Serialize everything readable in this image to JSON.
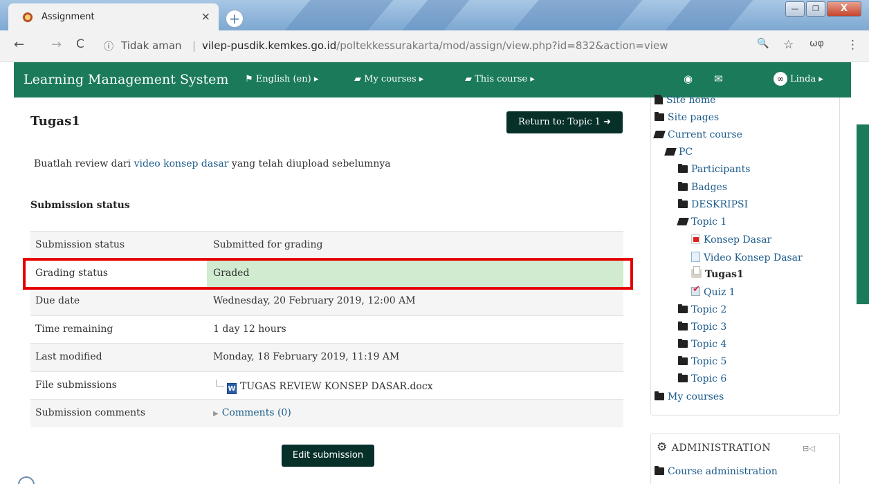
{
  "browser": {
    "tab_title": "Assignment",
    "tab_close": "×",
    "new_tab": "+",
    "window_controls": {
      "minimize": "—",
      "maximize": "❐",
      "close": "X"
    },
    "nav": {
      "back": "←",
      "forward": "→",
      "reload": "C"
    },
    "security_icon": "ⓘ",
    "security_label": "Tidak aman",
    "separator": "|",
    "url_domain": "vilep-pusdik.kemkes.go.id",
    "url_path": "/poltekkessurakarta/mod/assign/view.php?id=832&action=view",
    "zoom_icon": "🔍",
    "star_icon": "☆",
    "extension_label": "ωφ",
    "menu_icon": "⋮"
  },
  "navbar": {
    "brand": "Learning Management System",
    "language": "English (en)",
    "my_courses": "My courses",
    "this_course": "This course",
    "user_name": "Linda",
    "bg_color": "#1a7a5a"
  },
  "main": {
    "title": "Tugas1",
    "return_button": "Return to: Topic 1",
    "intro_prefix": "Buatlah review dari ",
    "intro_link": "video konsep dasar",
    "intro_suffix": " yang telah diupload sebelumnya",
    "section_heading": "Submission status",
    "rows": [
      {
        "label": "Submission status",
        "value": "Submitted for grading"
      },
      {
        "label": "Grading status",
        "value": "Graded"
      },
      {
        "label": "Due date",
        "value": "Wednesday, 20 February 2019, 12:00 AM"
      },
      {
        "label": "Time remaining",
        "value": "1 day 12 hours"
      },
      {
        "label": "Last modified",
        "value": "Monday, 18 February 2019, 11:19 AM"
      },
      {
        "label": "File submissions",
        "value": "TUGAS REVIEW KONSEP DASAR.docx"
      },
      {
        "label": "Submission comments",
        "value": "Comments (0)"
      }
    ],
    "edit_button": "Edit submission",
    "graded_color": "#d0ebd0",
    "highlight_color": "#e50000"
  },
  "sidebar": {
    "items": [
      {
        "label": "Site home",
        "icon": "page-icon"
      },
      {
        "label": "Site pages",
        "icon": "folder-icon"
      },
      {
        "label": "Current course",
        "icon": "folder-open-icon"
      },
      {
        "label": "PC",
        "icon": "folder-open-icon"
      },
      {
        "label": "Participants",
        "icon": "folder-icon"
      },
      {
        "label": "Badges",
        "icon": "folder-icon"
      },
      {
        "label": "DESKRIPSI",
        "icon": "folder-icon"
      },
      {
        "label": "Topic 1",
        "icon": "folder-open-icon"
      },
      {
        "label": "Konsep Dasar",
        "icon": "pdf-icon"
      },
      {
        "label": "Video Konsep Dasar",
        "icon": "file-icon"
      },
      {
        "label": "Tugas1",
        "icon": "assignment-icon"
      },
      {
        "label": "Quiz 1",
        "icon": "quiz-icon"
      },
      {
        "label": "Topic 2",
        "icon": "folder-icon"
      },
      {
        "label": "Topic 3",
        "icon": "folder-icon"
      },
      {
        "label": "Topic 4",
        "icon": "folder-icon"
      },
      {
        "label": "Topic 5",
        "icon": "folder-icon"
      },
      {
        "label": "Topic 6",
        "icon": "folder-icon"
      },
      {
        "label": "My courses",
        "icon": "folder-icon"
      }
    ],
    "admin_heading": "ADMINISTRATION",
    "admin_items": [
      {
        "label": "Course administration"
      }
    ]
  }
}
